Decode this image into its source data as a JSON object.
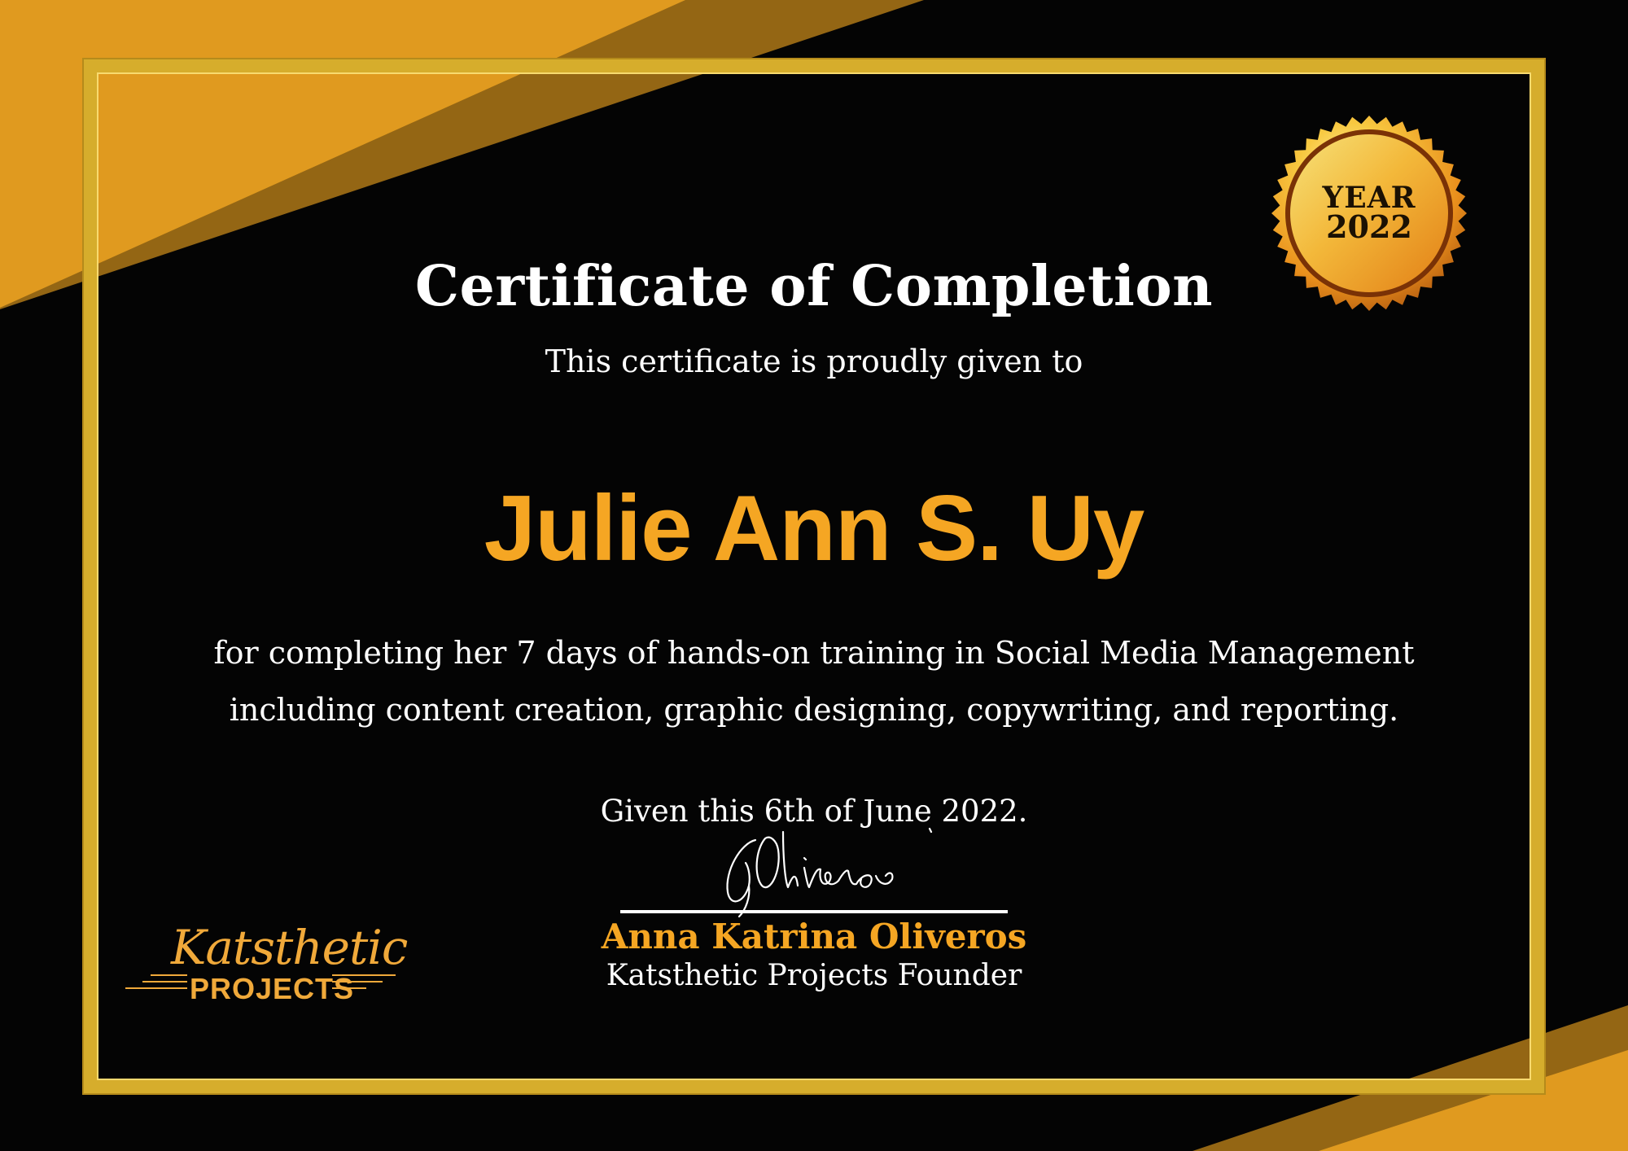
{
  "certificate": {
    "title": "Certificate of Completion",
    "subtitle": "This certificate is proudly given to",
    "recipient": "Julie Ann S. Uy",
    "body_line_1": "for completing her 7 days of hands-on training in Social Media Management",
    "body_line_2": "including content creation, graphic designing,  copywriting, and reporting.",
    "given_date": "Given this 6th of June 2022."
  },
  "seal": {
    "label": "YEAR",
    "year": "2022"
  },
  "signature": {
    "script_text": "GOliveros",
    "name": "Anna Katrina Oliveros",
    "role": "Katsthetic Projects Founder"
  },
  "logo": {
    "script": "Katsthetic",
    "word": "PROJECTS"
  },
  "colors": {
    "background": "#040404",
    "gold": "#e09a1f",
    "dark_gold": "#946614",
    "frame": "#d6ad2c",
    "accent_text": "#f5a623",
    "text": "#ffffff"
  }
}
